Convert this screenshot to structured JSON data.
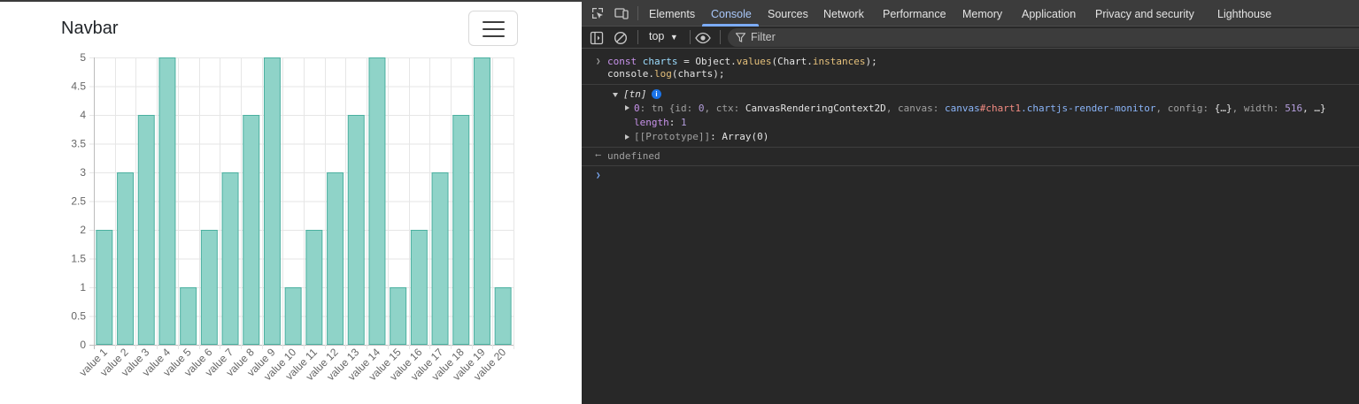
{
  "navbar": {
    "brand": "Navbar",
    "toggler_icon": "hamburger-icon"
  },
  "chart_data": {
    "type": "bar",
    "categories": [
      "value 1",
      "value 2",
      "value 3",
      "value 4",
      "value 5",
      "value 6",
      "value 7",
      "value 8",
      "value 9",
      "value 10",
      "value 11",
      "value 12",
      "value 13",
      "value 14",
      "value 15",
      "value 16",
      "value 17",
      "value 18",
      "value 19",
      "value 20"
    ],
    "values": [
      2,
      3,
      4,
      5,
      1,
      2,
      3,
      4,
      5,
      1,
      2,
      3,
      4,
      5,
      1,
      2,
      3,
      4,
      5,
      1
    ],
    "ylim": [
      0,
      5
    ],
    "yticks": [
      "0",
      "0.5",
      "1",
      "1.5",
      "2",
      "2.5",
      "3",
      "3.5",
      "4",
      "4.5",
      "5"
    ],
    "title": "",
    "xlabel": "",
    "ylabel": "",
    "grid": true,
    "bar_fill": "#8fd3c8",
    "bar_stroke": "#4bb0a0"
  },
  "devtools": {
    "tabs": [
      "Elements",
      "Console",
      "Sources",
      "Network",
      "Performance",
      "Memory",
      "Application",
      "Privacy and security",
      "Lighthouse"
    ],
    "active_tab": "Console",
    "context": "top",
    "filter_placeholder": "Filter",
    "console": {
      "input_kw": "const",
      "input_var": "charts",
      "input_eq": " = Object.",
      "input_fn": "values",
      "input_arg1": "(Chart.",
      "input_fn2": "instances",
      "input_end": ");",
      "input_line2_a": "console.",
      "input_line2_fn": "log",
      "input_line2_b": "(charts);",
      "array_label": "[tn]",
      "info_badge": "i",
      "item0_index": "0",
      "item0_colon": ": tn {",
      "item0_id_key": "id: ",
      "item0_id_val": "0",
      "item0_ctx_key": ", ctx: ",
      "item0_ctx_val": "CanvasRenderingContext2D",
      "item0_canvas_key": ", canvas: ",
      "item0_canvas_tag": "canvas",
      "item0_canvas_id": "#chart1",
      "item0_canvas_class": ".chartjs-render-monitor",
      "item0_config_key": ", config: ",
      "item0_config_val": "{…}",
      "item0_width_key": ", width: ",
      "item0_width_val": "516",
      "item0_rest": ", …}",
      "length_key": "length",
      "length_val": "1",
      "proto_key": "[[Prototype]]",
      "proto_val": "Array(0)",
      "result": "undefined"
    }
  }
}
